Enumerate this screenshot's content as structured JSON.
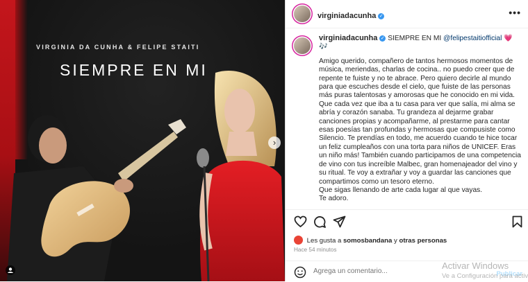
{
  "media": {
    "artists_line": "VIRGINIA DA CUNHA & FELIPE STAITI",
    "album_title": "SIEMPRE EN MI",
    "carousel": {
      "total": 4,
      "active_index": 0
    }
  },
  "header": {
    "username": "virginiadacunha",
    "more_label": "•••"
  },
  "caption": {
    "username": "virginiadacunha",
    "first_line": "SIEMPRE EN MI",
    "mention": "@felipestaitiofficial",
    "emojis": "💗 🎶",
    "body": "Amigo querido, compañero de tantos hermosos momentos de música, meriendas, charlas de cocina.. no puedo creer que de repente te fuiste y no te abrace. Pero quiero decirle al mundo para que escuches desde el cielo, que fuiste de las personas más puras talentosas y amorosas que he conocido en mi vida. Que cada vez que iba a tu casa para ver que salía, mi alma se abría y corazón sanaba. Tu grandeza al dejarme grabar canciones propias y acompañarme, al prestarme para cantar esas poesías tan profundas y hermosas que compusiste como Silencio. Te prendías en todo, me acuerdo cuando te hice tocar un feliz cumpleaños con una torta para niños de UNICEF. Eras un niño más! También cuando participamos de una competencia de vino con tus increíble Malbec, gran homenajeador del vino y su ritual. Te voy a extrañar y voy a guardar las canciones que compartimos como un tesoro eterno.\nQue sigas llenando de arte cada lugar al que vayas.\nTe adoro.\nV"
  },
  "likes": {
    "prefix": "Les gusta a",
    "user": "somosbandana",
    "suffix": "y",
    "others": "otras personas"
  },
  "time_ago": "Hace 54 minutos",
  "comment": {
    "placeholder": "Agrega un comentario...",
    "publish_label": "Publicar"
  },
  "watermark": {
    "line1": "Activar Windows",
    "line2": "Ve a Configuración para activar"
  },
  "colors": {
    "accent": "#3897f0",
    "link": "#00376b",
    "heart": "#ed4956",
    "stripe": "#c4161c"
  }
}
